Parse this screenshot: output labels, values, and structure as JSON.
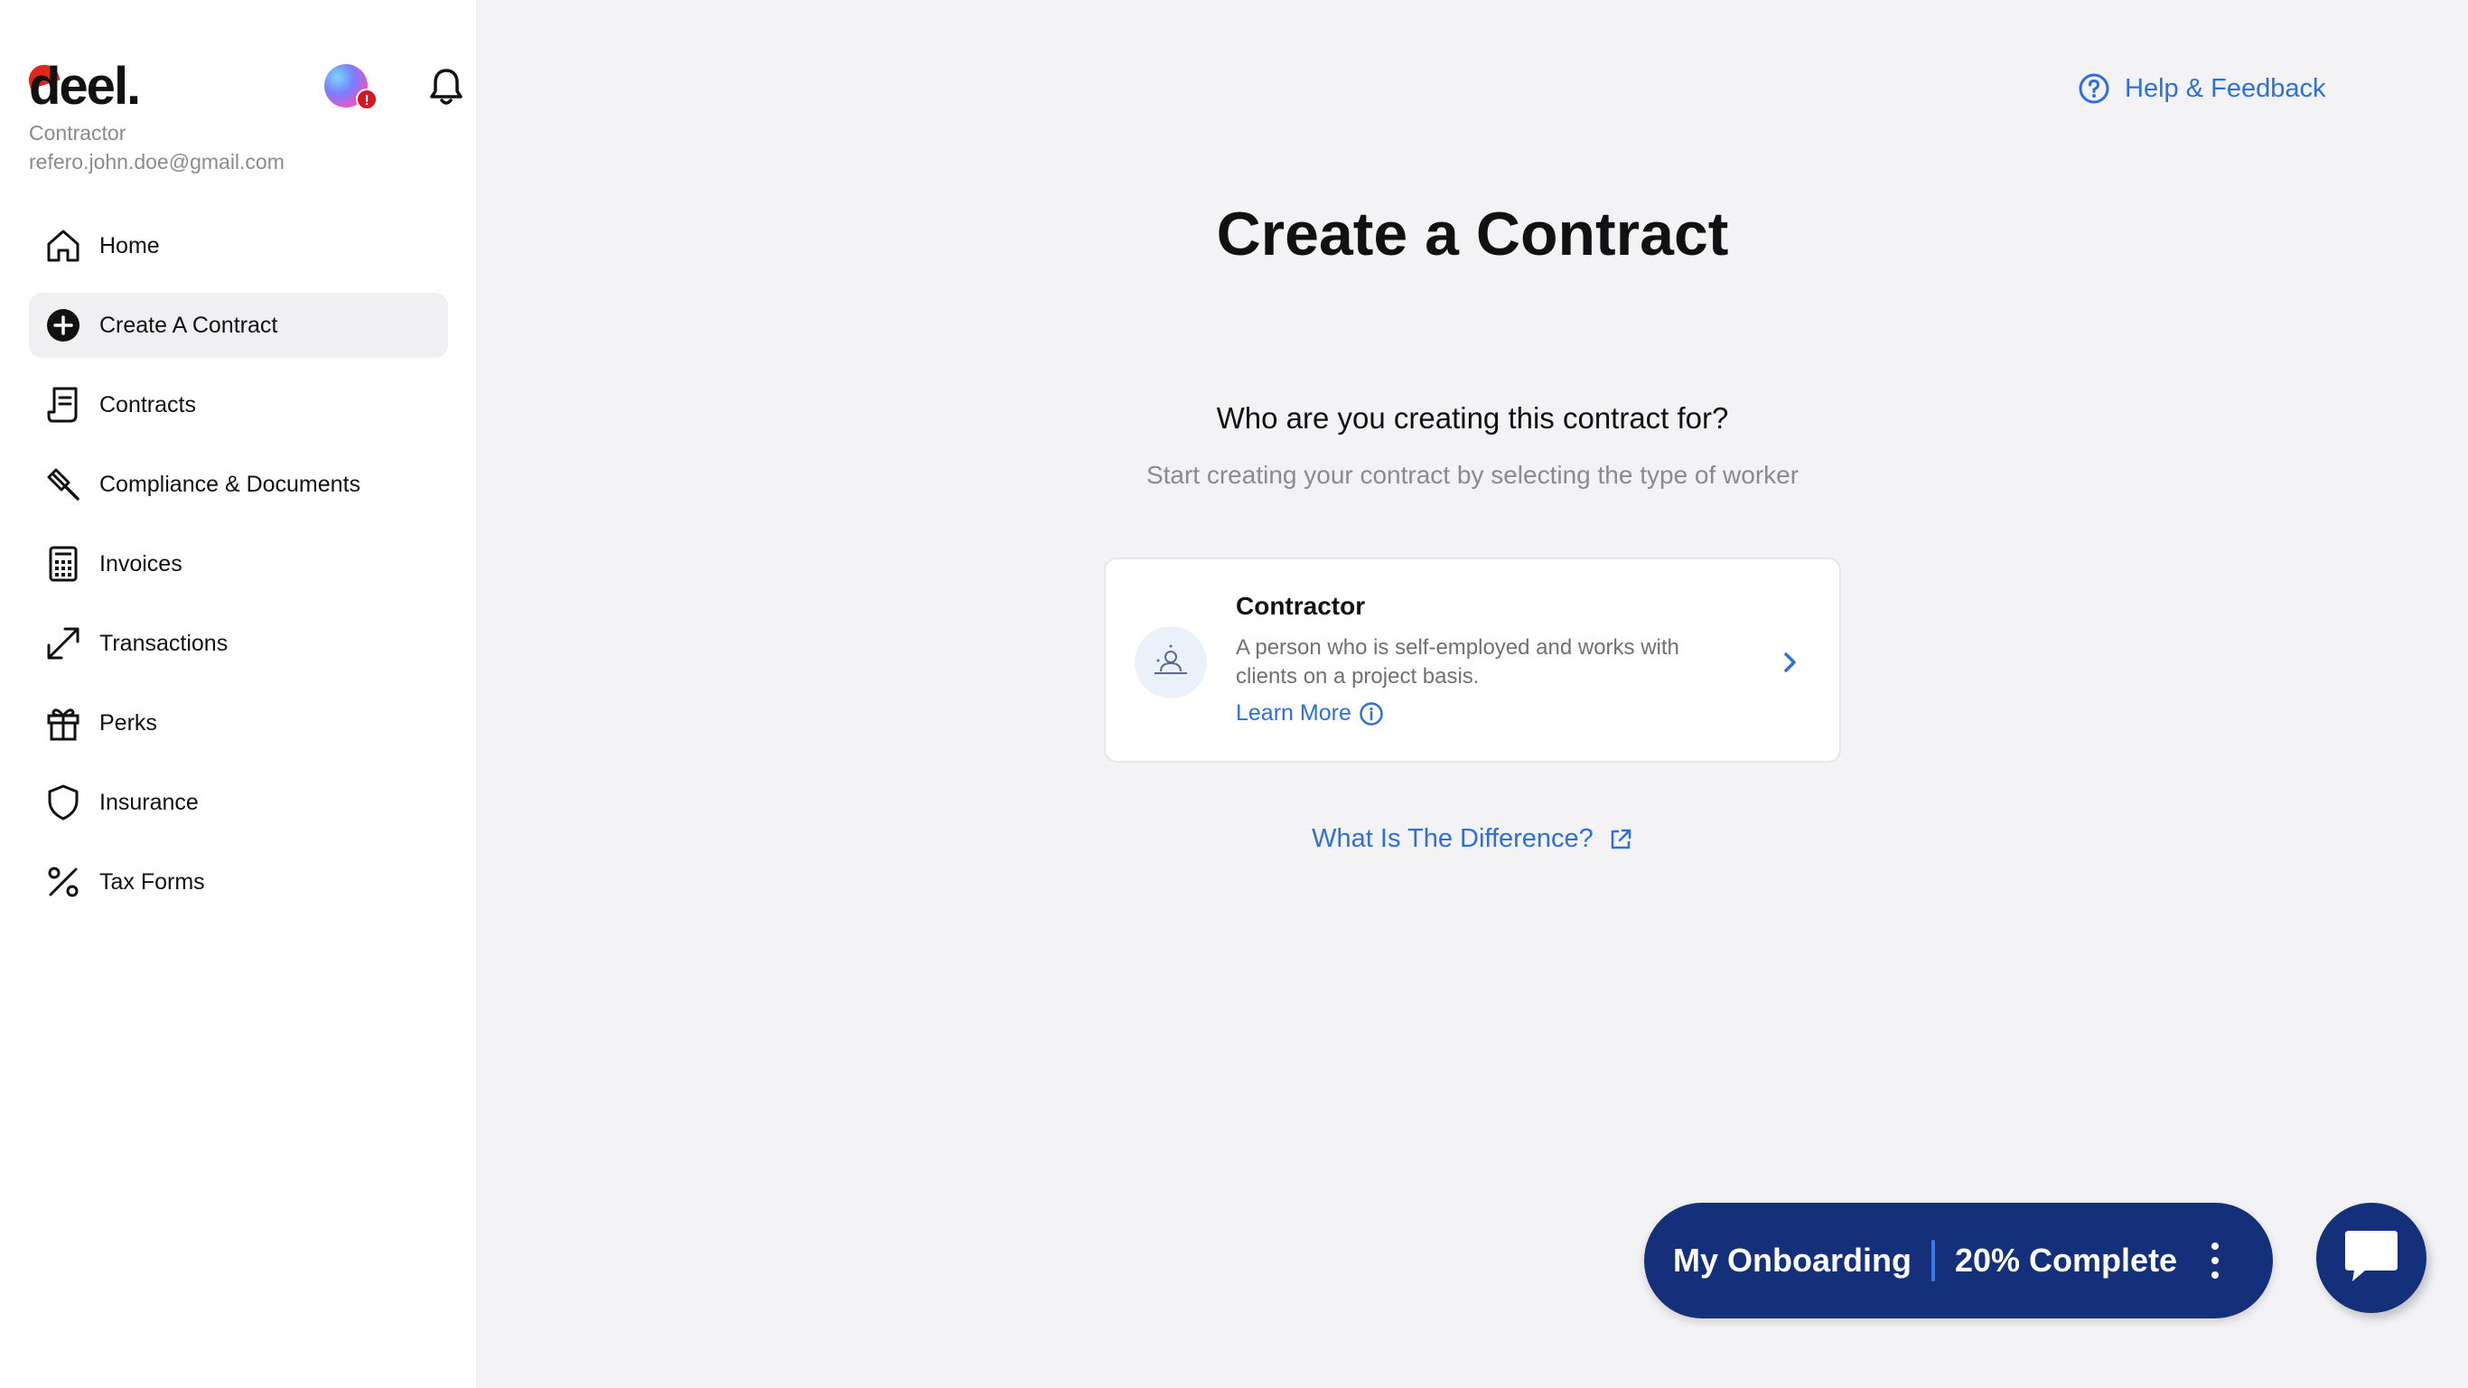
{
  "sidebar": {
    "logo": "deel.",
    "role": "Contractor",
    "email": "refero.john.doe@gmail.com",
    "avatar_badge": "!",
    "items": [
      {
        "label": "Home",
        "icon": "home-icon",
        "active": false
      },
      {
        "label": "Create A Contract",
        "icon": "plus-circle-icon",
        "active": true
      },
      {
        "label": "Contracts",
        "icon": "document-icon",
        "active": false
      },
      {
        "label": "Compliance & Documents",
        "icon": "gavel-icon",
        "active": false
      },
      {
        "label": "Invoices",
        "icon": "calculator-icon",
        "active": false
      },
      {
        "label": "Transactions",
        "icon": "arrows-icon",
        "active": false
      },
      {
        "label": "Perks",
        "icon": "gift-icon",
        "active": false
      },
      {
        "label": "Insurance",
        "icon": "shield-icon",
        "active": false
      },
      {
        "label": "Tax Forms",
        "icon": "percent-icon",
        "active": false
      }
    ]
  },
  "header": {
    "help_label": "Help & Feedback"
  },
  "main": {
    "title": "Create a Contract",
    "question": "Who are you creating this contract for?",
    "subtitle": "Start creating your contract by selecting the type of worker",
    "card": {
      "title": "Contractor",
      "description": "A person who is self-employed and works with clients on a project basis.",
      "learn_more": "Learn More"
    },
    "difference_link": "What Is The Difference?"
  },
  "onboarding": {
    "label": "My Onboarding",
    "progress_text": "20% Complete",
    "progress_percent": 20
  },
  "colors": {
    "accent_blue": "#2f6fdc",
    "navy": "#15307a",
    "brand_red": "#e1261c",
    "background": "#f3f3f5"
  }
}
